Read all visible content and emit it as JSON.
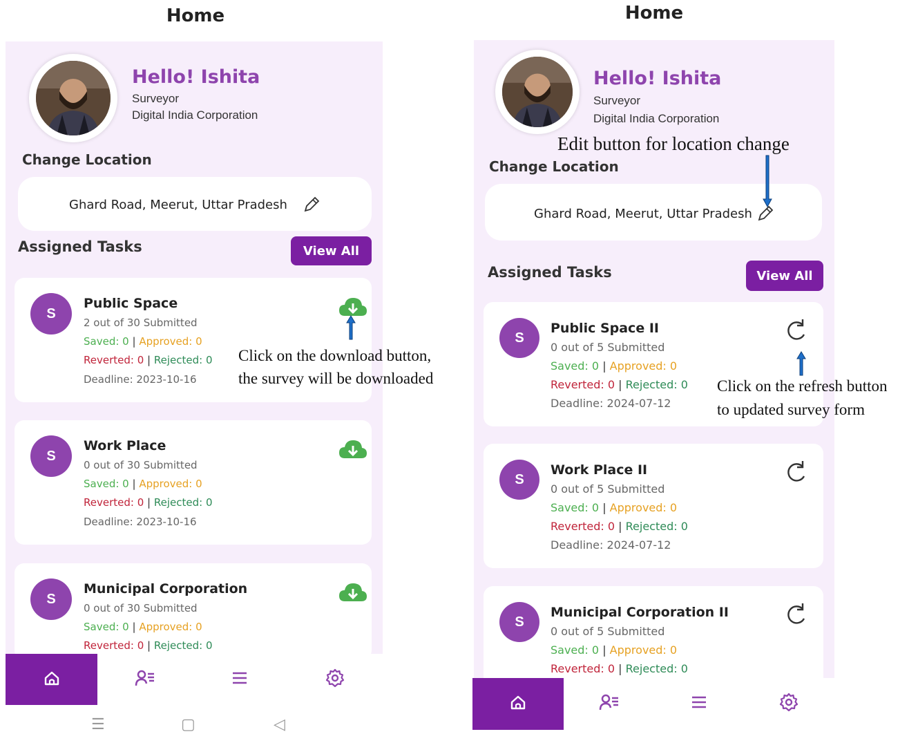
{
  "left": {
    "title": "Home",
    "greeting": "Hello! Ishita",
    "role": "Surveyor",
    "org": "Digital India Corporation",
    "change_location_label": "Change Location",
    "location": "Ghard Road, Meerut, Uttar Pradesh",
    "assigned_tasks_label": "Assigned Tasks",
    "view_all_label": "View All",
    "tasks": [
      {
        "initial": "S",
        "name": "Public Space",
        "submitted": "2 out of 30 Submitted",
        "saved": "Saved: 0",
        "approved": "Approved: 0",
        "reverted": "Reverted: 0",
        "rejected": "Rejected: 0",
        "deadline": "Deadline: 2023-10-16"
      },
      {
        "initial": "S",
        "name": "Work Place",
        "submitted": "0 out of 30 Submitted",
        "saved": "Saved: 0",
        "approved": "Approved: 0",
        "reverted": "Reverted: 0",
        "rejected": "Rejected: 0",
        "deadline": "Deadline: 2023-10-16"
      },
      {
        "initial": "S",
        "name": "Municipal Corporation",
        "submitted": "0 out of 30 Submitted",
        "saved": "Saved: 0",
        "approved": "Approved: 0",
        "reverted": "Reverted: 0",
        "rejected": "Rejected: 0"
      }
    ]
  },
  "right": {
    "title": "Home",
    "greeting": "Hello! Ishita",
    "role": "Surveyor",
    "org": "Digital India Corporation",
    "change_location_label": "Change Location",
    "location": "Ghard Road, Meerut, Uttar Pradesh",
    "assigned_tasks_label": "Assigned Tasks",
    "view_all_label": "View All",
    "tasks": [
      {
        "initial": "S",
        "name": "Public Space II",
        "submitted": "0 out of 5 Submitted",
        "saved": "Saved: 0",
        "approved": "Approved: 0",
        "reverted": "Reverted: 0",
        "rejected": "Rejected: 0",
        "deadline": "Deadline: 2024-07-12"
      },
      {
        "initial": "S",
        "name": "Work Place II",
        "submitted": "0 out of 5 Submitted",
        "saved": "Saved: 0",
        "approved": "Approved: 0",
        "reverted": "Reverted: 0",
        "rejected": "Rejected: 0",
        "deadline": "Deadline: 2024-07-12"
      },
      {
        "initial": "S",
        "name": "Municipal Corporation II",
        "submitted": "0 out of 5 Submitted",
        "saved": "Saved: 0",
        "approved": "Approved: 0",
        "reverted": "Reverted: 0",
        "rejected": "Rejected: 0"
      }
    ]
  },
  "separator": "|",
  "annotations": {
    "download_line1": "Click on the download button,",
    "download_line2": "the survey will be downloaded",
    "edit": "Edit button for location change",
    "refresh_line1": "Click on the refresh button",
    "refresh_line2": "to updated survey form"
  },
  "icons": {
    "nav": [
      "home-icon",
      "user-list-icon",
      "menu-icon",
      "settings-icon"
    ],
    "download": "cloud-download-icon",
    "refresh": "refresh-icon",
    "edit": "pencil-icon"
  },
  "colors": {
    "accent": "#7b1fa2",
    "greeting": "#8e44ad",
    "background": "#f7eefb",
    "download_green": "#4caf50",
    "annotation_arrow": "#1e6fc9"
  }
}
